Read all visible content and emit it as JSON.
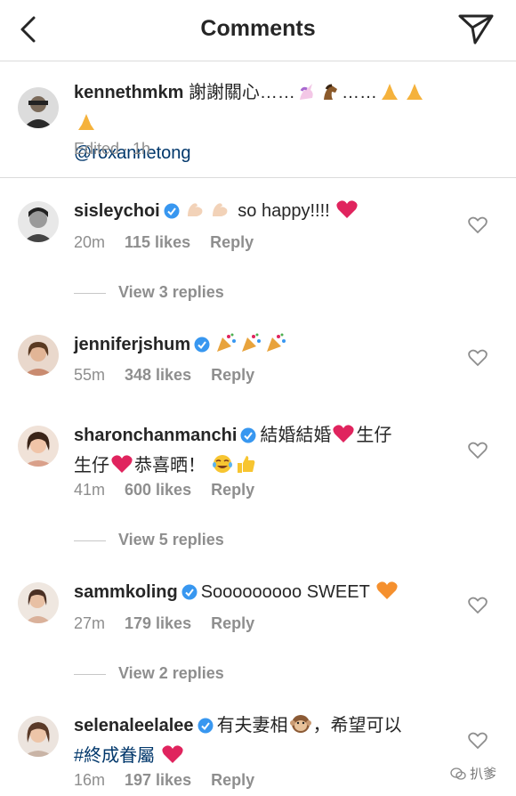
{
  "header": {
    "title": "Comments"
  },
  "caption": {
    "username": "kennethmkm",
    "text": "謝謝關心……",
    "ellipsis": "……",
    "mention": "@roxannetong",
    "edited": "Edited",
    "time": "· 1h"
  },
  "comments": [
    {
      "username": "sisleychoi",
      "text": "so happy!!!!",
      "time": "20m",
      "likes": "115 likes",
      "reply": "Reply",
      "view_replies": "View 3 replies"
    },
    {
      "username": "jenniferjshum",
      "text": "",
      "time": "55m",
      "likes": "348 likes",
      "reply": "Reply"
    },
    {
      "username": "sharonchanmanchi",
      "text1": "結婚結婚",
      "text2": "生仔",
      "text3": "生仔",
      "text4": "恭喜晒！",
      "time": "41m",
      "likes": "600 likes",
      "reply": "Reply",
      "view_replies": "View 5 replies"
    },
    {
      "username": "sammkoling",
      "text": "Sooooooooo SWEET",
      "time": "27m",
      "likes": "179 likes",
      "reply": "Reply",
      "view_replies": "View 2 replies"
    },
    {
      "username": "selenaleelalee",
      "text1": "有夫妻相",
      "text2": "，希望可以",
      "hashtag": "#終成眷屬",
      "time": "16m",
      "likes": "197 likes",
      "reply": "Reply"
    }
  ],
  "watermark": "扒爹"
}
